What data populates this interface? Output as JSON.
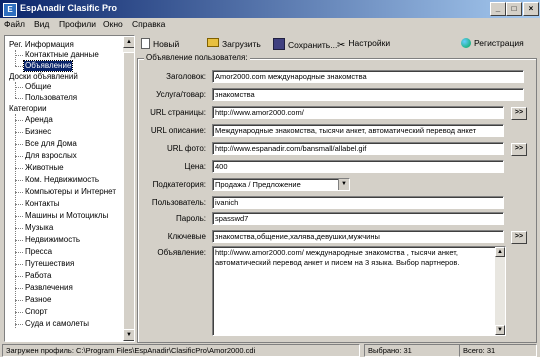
{
  "window": {
    "title": "EspAnadir Clasific Pro",
    "buttons": [
      "_",
      "□",
      "×"
    ]
  },
  "menu": [
    "Файл",
    "Вид",
    "Профили",
    "Окно",
    "Справка"
  ],
  "tree": {
    "root1": "Рег. Информация",
    "root1_children": [
      "Контактные данные",
      "Объявление"
    ],
    "root2": "Доски объявлений",
    "root2_children": [
      "Общие",
      "Пользователя"
    ],
    "root3": "Категории",
    "root3_children": [
      "Аренда",
      "Бизнес",
      "Все для Дома",
      "Для взрослых",
      "Животные",
      "Ком. Недвижимость",
      "Компьютеры и Интернет",
      "Контакты",
      "Машины и Мотоциклы",
      "Музыка",
      "Недвижимость",
      "Пресса",
      "Путешествия",
      "Работа",
      "Развлечения",
      "Разное",
      "Спорт",
      "Суда и самолеты"
    ]
  },
  "toolbar": {
    "new": "Новый",
    "load": "Загрузить",
    "save": "Сохранить...",
    "settings": "Настройки",
    "register": "Регистрация"
  },
  "form": {
    "group_title": "Объявление пользователя:",
    "fields": {
      "title_label": "Заголовок:",
      "title_value": "Amor2000.com  международные знакомства",
      "service_label": "Услуга/товар:",
      "service_value": "знакомства",
      "url_label": "URL страницы:",
      "url_value": "http://www.amor2000.com/",
      "urldesc_label": "URL описание:",
      "urldesc_value": "Международные знакомства, тысячи анкет, автоматический перевод анкет",
      "photo_label": "URL фото:",
      "photo_value": "http://www.espanadir.com/bansmall/allabel.gif",
      "price_label": "Цена:",
      "price_value": "400",
      "subcat_label": "Подкатегория:",
      "subcat_value": "Продажа / Предложение",
      "user_label": "Пользователь:",
      "user_value": "ivanich",
      "pass_label": "Пароль:",
      "pass_value": "spasswd7",
      "keywords_label": "Ключевые",
      "keywords_value": "знакомства,общение,халява,девушки,мужчины",
      "ad_label": "Объявление:",
      "ad_line1": "http://www.amor2000.com/  международные знакомства , тысячи анкет,",
      "ad_line2": "автоматический перевод анкет и писем на 3 языка. Выбор партнеров."
    },
    "go_label": ">>"
  },
  "status": {
    "profile": "Загружен профиль: C:\\Program Files\\EspAnadir\\ClasificPro\\Amor2000.cdi",
    "selected": "Выбрано: 31",
    "total": "Всего: 31"
  }
}
